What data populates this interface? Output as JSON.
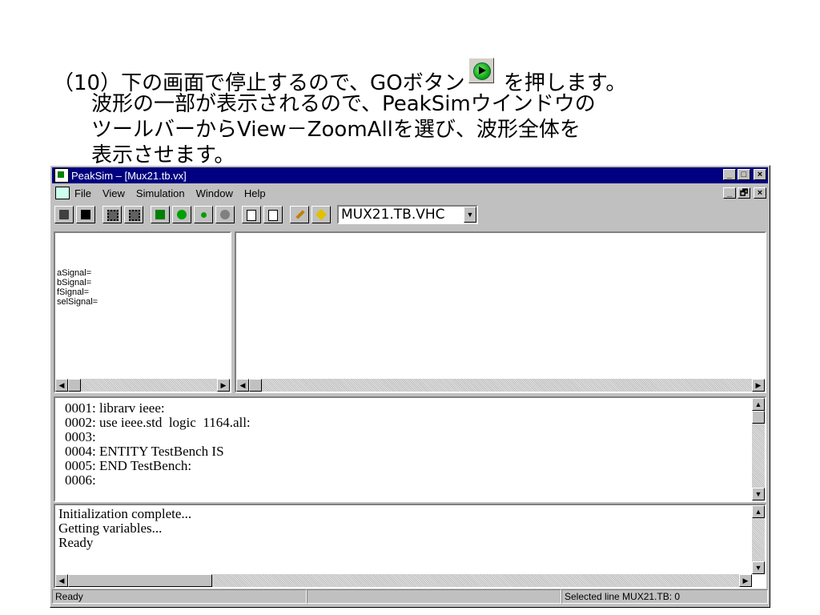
{
  "instruction": {
    "line1_before": "（10）下の画面で停止するので、GOボタン",
    "line1_after": " を押します。",
    "line2": "波形の一部が表示されるので、PeakSimウインドウの",
    "line3": "ツールバーからView－ZoomAllを選び、波形全体を",
    "line4": "表示させます。",
    "go_icon": "go-icon"
  },
  "window": {
    "title": "PeakSim – [Mux21.tb.vx]",
    "title_buttons": {
      "minimize": "_",
      "maximize": "□",
      "close": "×"
    },
    "mdi_buttons": {
      "minimize": "_",
      "restore": "🗗",
      "close": "×"
    },
    "menu": [
      "File",
      "View",
      "Simulation",
      "Window",
      "Help"
    ],
    "toolbar": {
      "icons": [
        "print-icon",
        "save-icon",
        "chip-icon",
        "chip2-icon",
        "back-icon",
        "go-icon",
        "step-icon",
        "stop-icon",
        "doc-icon",
        "doc2-icon",
        "wrench-icon",
        "diamond-icon"
      ],
      "combo_value": "MUX21.TB.VHC"
    },
    "signals": [
      "aSignal=",
      "bSignal=",
      "fSignal=",
      "selSignal="
    ],
    "code_lines": [
      "0001: librarv ieee:",
      "0002: use ieee.std  logic  1164.all:",
      "0003:",
      "0004: ENTITY TestBench IS",
      "0005: END TestBench:",
      "0006:"
    ],
    "log_lines": [
      "Initialization complete...",
      "Getting variables...",
      "Ready"
    ],
    "status": {
      "left": "Ready",
      "middle": "",
      "right": "Selected line MUX21.TB: 0"
    }
  }
}
